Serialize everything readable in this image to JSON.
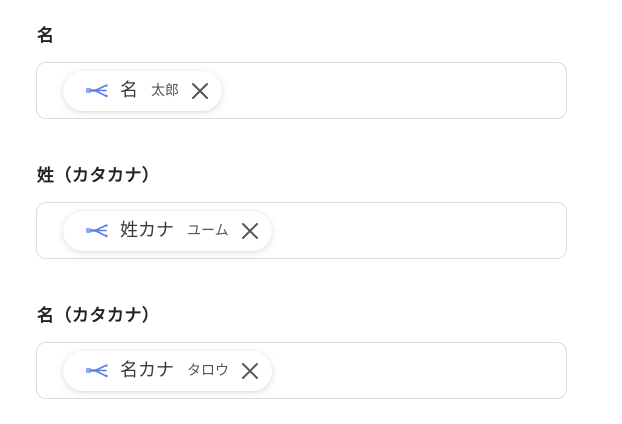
{
  "colors": {
    "icon_blue": "#5b7fe0",
    "close_gray": "#555555",
    "border": "#d9dde3"
  },
  "fields": [
    {
      "label": "名",
      "chip": {
        "icon": "flow-node-icon",
        "name": "名",
        "value": "太郎"
      }
    },
    {
      "label": "姓（カタカナ）",
      "chip": {
        "icon": "flow-node-icon",
        "name": "姓カナ",
        "value": "ユーム"
      }
    },
    {
      "label": "名（カタカナ）",
      "chip": {
        "icon": "flow-node-icon",
        "name": "名カナ",
        "value": "タロウ"
      }
    }
  ]
}
